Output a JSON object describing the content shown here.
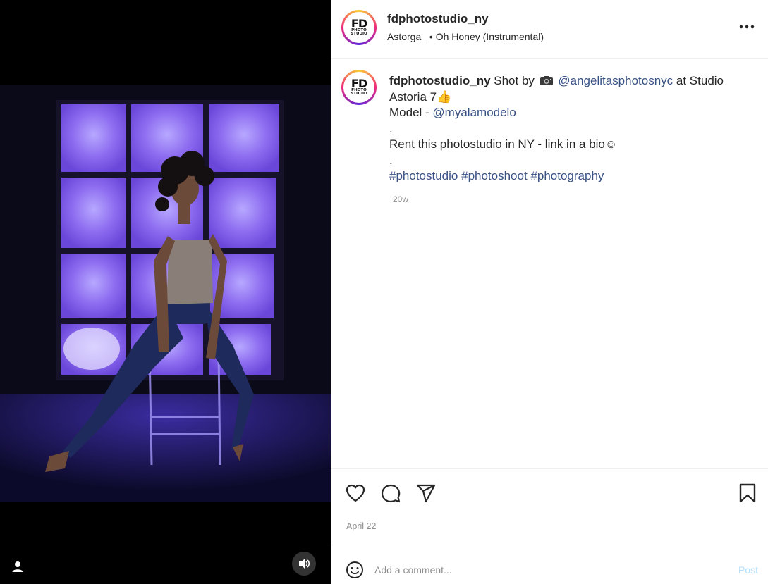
{
  "post": {
    "username": "fdphotostudio_ny",
    "audio": "Astorga_ • Oh Honey (Instrumental)",
    "avatar": {
      "line1": "FD",
      "line2": "PHOTO",
      "line3": "STUDIO"
    },
    "caption": {
      "username": "fdphotostudio_ny",
      "text1": " Shot by ",
      "mention1": "@angelitasphotosnyc",
      "text2": " at Studio Astoria 7",
      "thumb": "👍",
      "model_prefix": "Model - ",
      "mention2": "@myalamodelo",
      "dot1": ".",
      "rent": "Rent this photostudio in NY - link in a bio☺",
      "dot2": ".",
      "hashtags": [
        "#photostudio",
        "#photoshoot",
        "#photography"
      ]
    },
    "age": "20w",
    "date": "April 22"
  },
  "comment": {
    "placeholder": "Add a comment...",
    "post_label": "Post"
  },
  "icons": {
    "more": "more-options-icon",
    "like": "heart-icon",
    "comment": "comment-icon",
    "share": "paper-plane-icon",
    "save": "bookmark-icon",
    "emoji": "emoji-icon",
    "user": "user-tag-icon",
    "sound": "speaker-icon",
    "camera": "camera-emoji-icon"
  },
  "colors": {
    "link": "#385185",
    "muted": "#8e8e8e",
    "post_disabled": "#b2dffc"
  }
}
